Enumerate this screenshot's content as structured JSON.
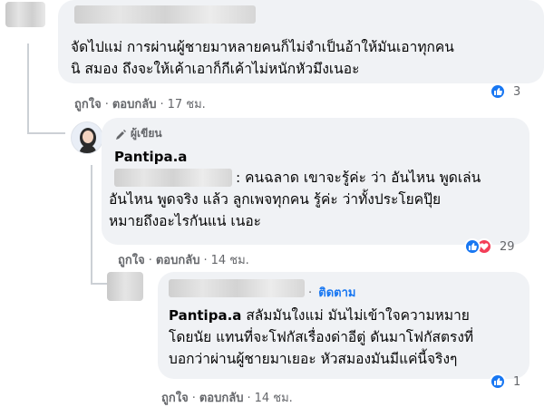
{
  "comment1": {
    "text_line1": "จัดไปแม่ การผ่านผู้ชายมาหลายคนก็ไม่จำเป็นอ้าให้มันเอาทุกคน",
    "text_line2": "นิ สมอง ถึงจะให้เค้าเอาก็กีเค้าไม่หนักหัวมึงเนอะ",
    "like_label": "ถูกใจ",
    "reply_label": "ตอบกลับ",
    "time": "17 ชม.",
    "reaction_count": "3"
  },
  "comment2": {
    "badge": "ผู้เขียน",
    "author": "Pantipa.a",
    "text_line1": ": คนฉลาด เขาจะรู้ค่ะ ว่า อันไหน พูดเล่น",
    "text_line2": "อันไหน พูดจริง แล้ว ลูกเพจทุกคน รู้ค่ะ ว่าทั้งประโยคปุ๊ย",
    "text_line3": "หมายถึงอะไรกันแน่ เนอะ",
    "like_label": "ถูกใจ",
    "reply_label": "ตอบกลับ",
    "time": "14 ชม.",
    "reaction_count": "29"
  },
  "comment3": {
    "follow_label": "ติดตาม",
    "mention": "Pantipa.a",
    "text_line1": "สลัมมันใงแม่ มันไม่เข้าใจความหมาย",
    "text_line2": "โดยนัย แทนที่จะโฟกัสเรื่องด่าอีตู่ ดันมาโฟกัสตรงที่",
    "text_line3": "บอกว่าผ่านผู้ชายมาเยอะ หัวสมองมันมีแค่นี้จริงๆ",
    "like_label": "ถูกใจ",
    "reply_label": "ตอบกลับ",
    "time": "14 ชม.",
    "reaction_count": "1"
  },
  "separator": "·",
  "colors": {
    "bubble": "#f0f2f5",
    "action_text": "#65676b",
    "link_blue": "#1877f2",
    "like_blue": "#1877f2",
    "love_red": "#f33e58"
  },
  "icons": [
    "like-icon",
    "love-icon",
    "pen-icon"
  ]
}
